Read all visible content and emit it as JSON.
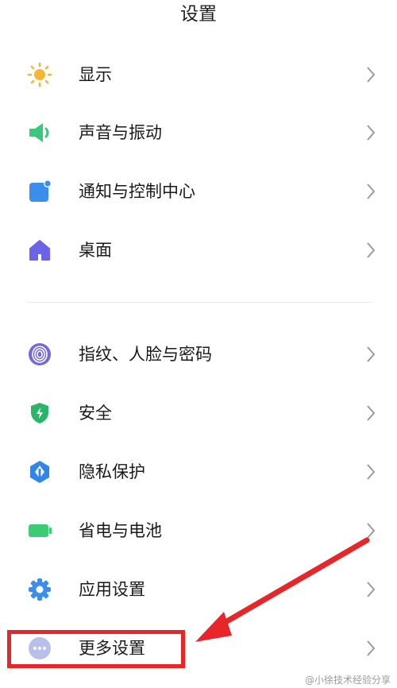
{
  "header": {
    "title": "设置"
  },
  "items": [
    {
      "label": "显示",
      "icon": "sun-icon",
      "color": "#F5B731"
    },
    {
      "label": "声音与振动",
      "icon": "speaker-icon",
      "color": "#3DC77A"
    },
    {
      "label": "通知与控制中心",
      "icon": "notification-icon",
      "color": "#3B8EEA"
    },
    {
      "label": "桌面",
      "icon": "home-icon",
      "color": "#6C63E8"
    },
    {
      "label": "指纹、人脸与密码",
      "icon": "fingerprint-icon",
      "color": "#7467E0"
    },
    {
      "label": "安全",
      "icon": "shield-icon",
      "color": "#2BB56B"
    },
    {
      "label": "隐私保护",
      "icon": "privacy-icon",
      "color": "#2F86E8"
    },
    {
      "label": "省电与电池",
      "icon": "battery-icon",
      "color": "#3CCB73"
    },
    {
      "label": "应用设置",
      "icon": "gear-icon",
      "color": "#3B8EEA"
    },
    {
      "label": "更多设置",
      "icon": "more-icon",
      "color": "#B7BFEA"
    }
  ],
  "annotation": {
    "color": "#E8262A"
  },
  "watermark": {
    "text": "@小徐技术经验分享"
  }
}
